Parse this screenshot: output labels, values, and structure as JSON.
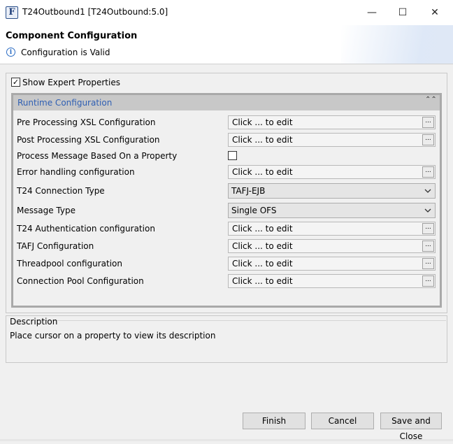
{
  "window": {
    "app_icon_letter": "F",
    "title": "T24Outbound1 [T24Outbound:5.0]",
    "minimize_glyph": "—",
    "maximize_glyph": "☐",
    "close_glyph": "✕"
  },
  "header": {
    "title": "Component Configuration",
    "info_glyph": "i",
    "status": "Configuration is Valid"
  },
  "expert": {
    "checked": true,
    "check_glyph": "✓",
    "label": "Show Expert Properties"
  },
  "section": {
    "title": "Runtime Configuration",
    "collapse_glyph": "⌃⌃"
  },
  "properties": [
    {
      "label": "Pre Processing XSL Configuration",
      "type": "edit",
      "value": "Click ... to edit",
      "button": "..."
    },
    {
      "label": "Post Processing XSL Configuration",
      "type": "edit",
      "value": "Click ... to edit",
      "button": "..."
    },
    {
      "label": "Process Message Based On a Property",
      "type": "checkbox",
      "checked": false
    },
    {
      "label": "Error handling configuration",
      "type": "edit",
      "value": "Click ... to edit",
      "button": "..."
    },
    {
      "label": "T24 Connection Type",
      "type": "combo",
      "value": "TAFJ-EJB"
    },
    {
      "label": "Message Type",
      "type": "combo",
      "value": "Single OFS"
    },
    {
      "label": "T24 Authentication configuration",
      "type": "edit",
      "value": "Click ... to edit",
      "button": "..."
    },
    {
      "label": "TAFJ Configuration",
      "type": "edit",
      "value": "Click ... to edit",
      "button": "..."
    },
    {
      "label": "Threadpool configuration",
      "type": "edit",
      "value": "Click ... to edit",
      "button": "..."
    },
    {
      "label": "Connection Pool Configuration",
      "type": "edit",
      "value": "Click ... to edit",
      "button": "..."
    }
  ],
  "description": {
    "title": "Description",
    "text": "Place cursor on a property to view its description"
  },
  "buttons": {
    "finish": "Finish",
    "cancel": "Cancel",
    "save_close": "Save and Close"
  },
  "colors": {
    "section_title": "#2f5fb3",
    "info_icon": "#2b6cc4"
  }
}
